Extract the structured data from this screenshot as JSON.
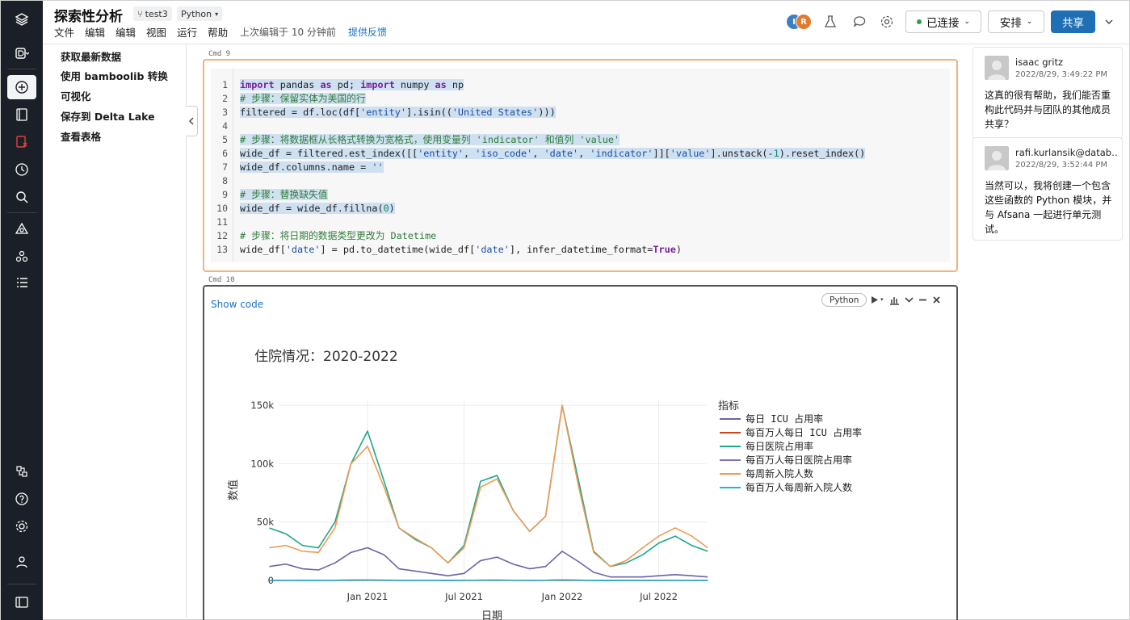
{
  "header": {
    "title": "探索性分析",
    "branch": "test3",
    "language": "Python",
    "menu": [
      "文件",
      "编辑",
      "编辑",
      "视图",
      "运行",
      "帮助"
    ],
    "last_edited": "上次编辑于 10 分钟前",
    "feedback": "提供反馈",
    "avatars": [
      "I",
      "R"
    ],
    "connect": "已连接",
    "schedule": "安排",
    "share": "共享"
  },
  "toc": [
    "获取最新数据",
    "使用 bamboolib 转换",
    "可视化",
    "保存到 Delta Lake",
    "查看表格"
  ],
  "cells": {
    "cmd9": "Cmd 9",
    "cmd10": "Cmd 10",
    "show_code": "Show code",
    "cell_language": "Python"
  },
  "code_lines": [
    "1",
    "2",
    "3",
    "4",
    "5",
    "6",
    "7",
    "8",
    "9",
    "10",
    "11",
    "12",
    "13"
  ],
  "chart_data": {
    "type": "line",
    "title": "住院情况：2020-2022",
    "xlabel": "日期",
    "ylabel": "数值",
    "ylim": [
      0,
      155000
    ],
    "y_ticks": [
      "0",
      "50k",
      "100k",
      "150k"
    ],
    "x_ticks": [
      "Jan 2021",
      "Jul 2021",
      "Jan 2022",
      "Jul 2022"
    ],
    "legend_title": "指标",
    "legend_position": "right",
    "x": [
      "2020-07",
      "2020-08",
      "2020-09",
      "2020-10",
      "2020-11",
      "2020-12",
      "2021-01",
      "2021-02",
      "2021-03",
      "2021-04",
      "2021-05",
      "2021-06",
      "2021-07",
      "2021-08",
      "2021-09",
      "2021-10",
      "2021-11",
      "2021-12",
      "2022-01",
      "2022-02",
      "2022-03",
      "2022-04",
      "2022-05",
      "2022-06",
      "2022-07",
      "2022-08",
      "2022-09",
      "2022-10"
    ],
    "series": [
      {
        "name": "每日 ICU 占用率",
        "color": "#6b63a8",
        "values": [
          12000,
          14000,
          10000,
          9000,
          15000,
          24000,
          28000,
          22000,
          10000,
          8000,
          6000,
          4000,
          6000,
          17000,
          20000,
          14000,
          10000,
          12000,
          25000,
          16000,
          7000,
          3000,
          3000,
          3000,
          4000,
          5000,
          4000,
          3000
        ]
      },
      {
        "name": "每百万人每日 ICU 占用率",
        "color": "#d0421b",
        "values": [
          40,
          45,
          30,
          28,
          48,
          70,
          85,
          65,
          30,
          25,
          18,
          12,
          20,
          50,
          60,
          42,
          30,
          36,
          75,
          48,
          20,
          9,
          9,
          9,
          12,
          15,
          12,
          9
        ]
      },
      {
        "name": "每日医院占用率",
        "color": "#1fa68a",
        "values": [
          45000,
          40000,
          30000,
          28000,
          50000,
          100000,
          128000,
          85000,
          45000,
          35000,
          28000,
          15000,
          30000,
          85000,
          90000,
          60000,
          42000,
          55000,
          150000,
          85000,
          25000,
          12000,
          15000,
          22000,
          32000,
          38000,
          30000,
          25000
        ]
      },
      {
        "name": "每百万人每日医院占用率",
        "color": "#7c6fc2",
        "values": [
          140,
          120,
          90,
          85,
          150,
          300,
          385,
          255,
          135,
          105,
          85,
          45,
          90,
          255,
          270,
          180,
          125,
          165,
          450,
          255,
          75,
          36,
          45,
          66,
          96,
          114,
          90,
          75
        ]
      },
      {
        "name": "每周新入院人数",
        "color": "#ef9a55",
        "values": [
          28000,
          30000,
          25000,
          24000,
          45000,
          100000,
          115000,
          80000,
          45000,
          36000,
          28000,
          15000,
          28000,
          80000,
          87000,
          60000,
          42000,
          55000,
          150000,
          80000,
          24000,
          12000,
          17000,
          28000,
          38000,
          45000,
          38000,
          28000
        ]
      },
      {
        "name": "每百万人每周新入院人数",
        "color": "#22b7c9",
        "values": [
          85,
          90,
          75,
          72,
          135,
          300,
          345,
          240,
          135,
          108,
          84,
          45,
          84,
          240,
          261,
          180,
          126,
          165,
          450,
          240,
          72,
          36,
          51,
          84,
          114,
          135,
          114,
          84
        ]
      }
    ]
  },
  "comments": [
    {
      "name": "isaac gritz",
      "time": "2022/8/29, 3:49:22 PM",
      "body": "这真的很有帮助，我们能否重构此代码并与团队的其他成员共享？"
    },
    {
      "name": "rafi.kurlansik@datab…",
      "time": "2022/8/29, 3:52:44 PM",
      "body": "当然可以，我将创建一个包含这些函数的 Python 模块，并与 Afsana 一起进行单元测试。"
    }
  ],
  "colors": {
    "accent": "#1f6fb5",
    "rail": "#1b2028",
    "active_cell": "#f2b27c"
  }
}
